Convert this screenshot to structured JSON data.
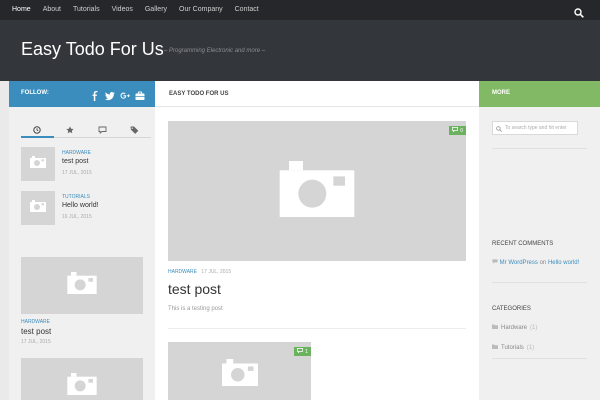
{
  "nav": {
    "items": [
      "Home",
      "About",
      "Tutorials",
      "Videos",
      "Gallery",
      "Our Company",
      "Contact"
    ]
  },
  "header": {
    "title": "Easy Todo For Us",
    "tagline": "– Programming Electronic and more –"
  },
  "left": {
    "follow_label": "FOLLOW:",
    "social_icons": [
      "facebook-icon",
      "twitter-icon",
      "google-plus-icon",
      "briefcase-icon"
    ],
    "tabs": [
      "recent-icon",
      "star-icon",
      "comments-icon",
      "tags-icon"
    ],
    "recent_posts": [
      {
        "category": "HARDWARE",
        "title": "test post",
        "date": "17 JUL, 2015"
      },
      {
        "category": "TUTORIALS",
        "title": "Hello world!",
        "date": "16 JUL, 2015"
      }
    ],
    "featured_post": {
      "category": "HARDWARE",
      "title": "test post",
      "date": "17 JUL, 2015"
    }
  },
  "main": {
    "heading": "EASY TODO FOR US",
    "post": {
      "comments": "0",
      "category": "HARDWARE",
      "date": "17 JUL, 2015",
      "title": "test post",
      "excerpt": "This is a testing post"
    },
    "post2": {
      "comments": "1"
    }
  },
  "right": {
    "more_label": "MORE",
    "search_placeholder": "To search type and hit enter",
    "recent_comments_title": "RECENT COMMENTS",
    "recent_comment": {
      "author": "Mr WordPress",
      "on": "on",
      "post": "Hello world!"
    },
    "categories_title": "CATEGORIES",
    "categories": [
      {
        "name": "Hardware",
        "count": "(1)"
      },
      {
        "name": "Tutorials",
        "count": "(1)"
      }
    ]
  },
  "colors": {
    "nav_bg": "#26272b",
    "header_bg": "#33363b",
    "follow_blue": "#3b8dbd",
    "more_green": "#82b965",
    "badge_green": "#6bb25f"
  }
}
